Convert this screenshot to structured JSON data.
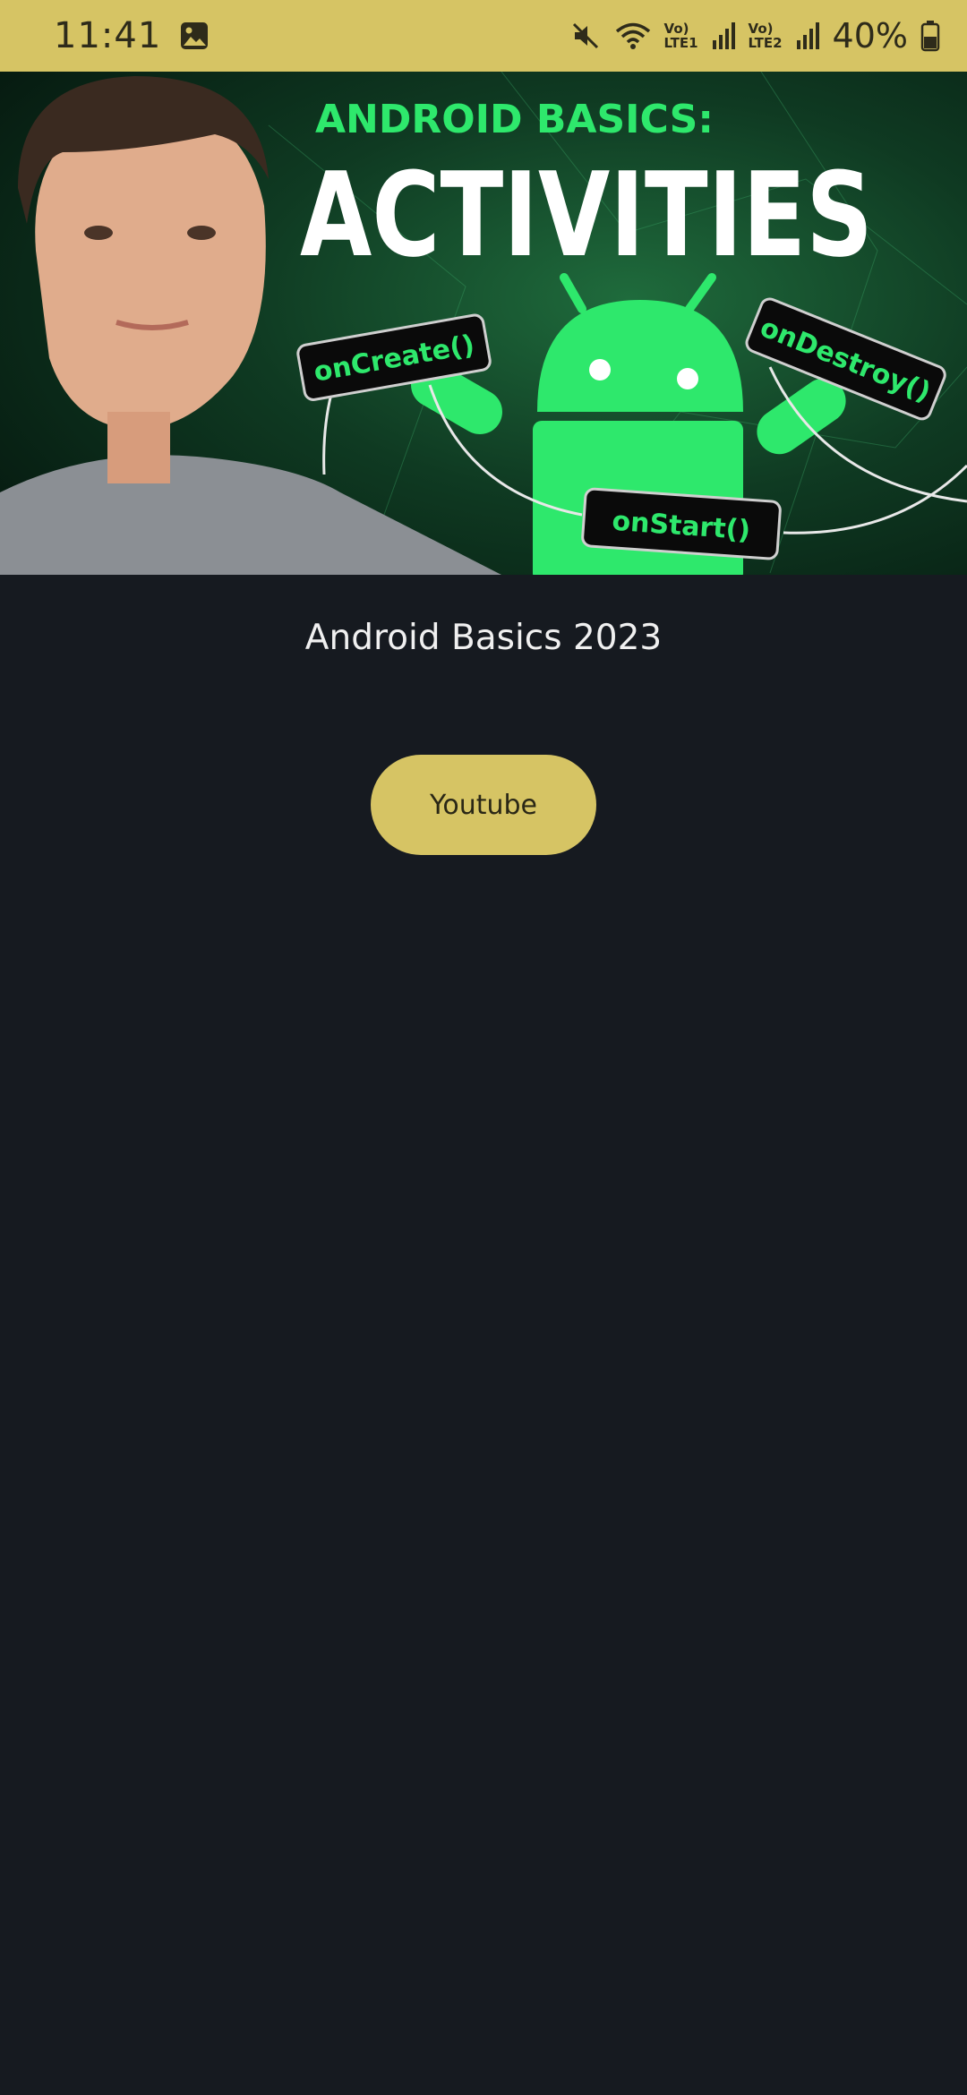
{
  "status_bar": {
    "time": "11:41",
    "battery_percent": "40%",
    "sim1_top": "Vo)",
    "sim1_bottom": "LTE1",
    "sim2_top": "Vo)",
    "sim2_bottom": "LTE2",
    "background_color": "#d6c464"
  },
  "hero": {
    "kicker": "ANDROID BASICS:",
    "headline": "ACTIVITIES",
    "tags": {
      "create": "onCreate()",
      "destroy": "onDestroy()",
      "start": "onStart()"
    },
    "accent_color": "#2ee86c"
  },
  "main": {
    "title": "Android Basics 2023",
    "youtube_button_label": "Youtube",
    "button_color": "#d6c464",
    "background_color": "#161a20"
  }
}
